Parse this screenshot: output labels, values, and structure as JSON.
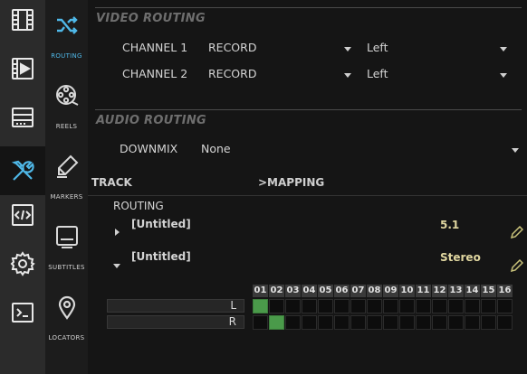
{
  "rail": [
    {
      "name": "film-icon",
      "active": false
    },
    {
      "name": "video-play-icon",
      "active": false
    },
    {
      "name": "storage-icon",
      "active": false
    },
    {
      "name": "tools-icon",
      "active": true
    },
    {
      "name": "code-icon",
      "active": false
    },
    {
      "name": "gear-icon",
      "active": false
    },
    {
      "name": "terminal-icon",
      "active": false
    }
  ],
  "submenu": [
    {
      "label": "ROUTING",
      "icon": "shuffle-icon",
      "active": true
    },
    {
      "label": "REELS",
      "icon": "film-reel-icon",
      "active": false
    },
    {
      "label": "MARKERS",
      "icon": "marker-icon",
      "active": false
    },
    {
      "label": "SUBTITLES",
      "icon": "subtitles-icon",
      "active": false
    },
    {
      "label": "LOCATORS",
      "icon": "location-pin-icon",
      "active": false
    }
  ],
  "video_routing": {
    "title": "VIDEO ROUTING",
    "channels": [
      {
        "label": "CHANNEL 1",
        "mode": "RECORD",
        "side": "Left"
      },
      {
        "label": "CHANNEL 2",
        "mode": "RECORD",
        "side": "Left"
      }
    ]
  },
  "audio_routing": {
    "title": "AUDIO ROUTING",
    "downmix_label": "DOWNMIX",
    "downmix_value": "None"
  },
  "table": {
    "track_header": "TRACK",
    "mapping_header": ">MAPPING",
    "routing_label": "ROUTING",
    "tracks": [
      {
        "name": "[Untitled]",
        "format": "5.1",
        "expanded": false
      },
      {
        "name": "[Untitled]",
        "format": "Stereo",
        "expanded": true
      }
    ]
  },
  "matrix": {
    "columns": [
      "01",
      "02",
      "03",
      "04",
      "05",
      "06",
      "07",
      "08",
      "09",
      "10",
      "11",
      "12",
      "13",
      "14",
      "15",
      "16"
    ],
    "rows": [
      {
        "label": "L",
        "active_column": "01"
      },
      {
        "label": "R",
        "active_column": "02"
      }
    ],
    "active_color": "#4a9a4a"
  },
  "colors": {
    "accent": "#4fb8e8",
    "format_text": "#e0d6a0",
    "pencil": "#c8c27a"
  }
}
